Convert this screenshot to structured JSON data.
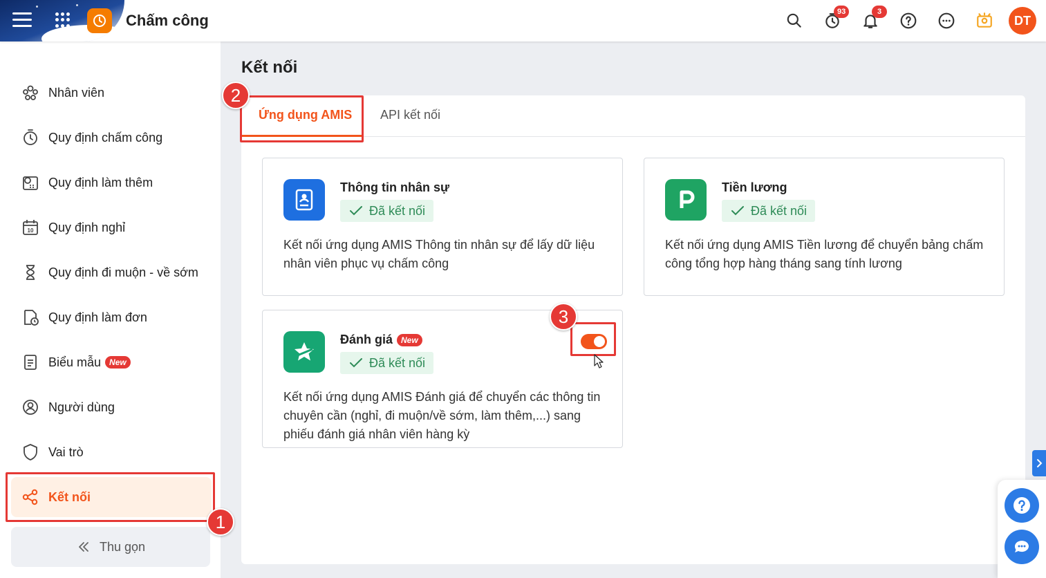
{
  "app": {
    "title": "Chấm công"
  },
  "header": {
    "timer_badge": "93",
    "notification_badge": "3",
    "avatar_initials": "DT",
    "icons": [
      "search-icon",
      "timer-icon",
      "bell-icon",
      "help-icon",
      "more-icon",
      "idea-icon"
    ]
  },
  "sidebar": {
    "items": [
      {
        "label": "Nhân viên",
        "icon": "employees-icon"
      },
      {
        "label": "Quy định chấm công",
        "icon": "stopwatch-icon"
      },
      {
        "label": "Quy định làm thêm",
        "icon": "overtime-icon"
      },
      {
        "label": "Quy định nghỉ",
        "icon": "calendar-icon"
      },
      {
        "label": "Quy định đi muộn - về sớm",
        "icon": "hourglass-icon"
      },
      {
        "label": "Quy định làm đơn",
        "icon": "document-clock-icon"
      },
      {
        "label": "Biểu mẫu",
        "icon": "form-icon",
        "badge": "New"
      },
      {
        "label": "Người dùng",
        "icon": "user-icon"
      },
      {
        "label": "Vai trò",
        "icon": "shield-icon"
      },
      {
        "label": "Kết nối",
        "icon": "share-icon",
        "active": true
      }
    ],
    "collapse_label": "Thu gọn"
  },
  "main": {
    "page_title": "Kết nối",
    "tabs": [
      {
        "label": "Ứng dụng AMIS",
        "active": true
      },
      {
        "label": "API kết nối",
        "active": false
      }
    ],
    "cards": [
      {
        "title": "Thông tin nhân sự",
        "status": "Đã kết nối",
        "description": "Kết nối ứng dụng AMIS Thông tin nhân sự để lấy dữ liệu nhân viên phục vụ chấm công",
        "icon_color": "#1e6fe0"
      },
      {
        "title": "Tiền lương",
        "status": "Đã kết nối",
        "description": "Kết nối ứng dụng AMIS Tiền lương để chuyển bảng chấm công tổng hợp hàng tháng sang tính lương",
        "icon_color": "#1fa463"
      },
      {
        "title": "Đánh giá",
        "badge": "New",
        "status": "Đã kết nối",
        "description": "Kết nối ứng dụng AMIS Đánh giá để chuyển các thông tin chuyên cần (nghỉ, đi muộn/về sớm, làm thêm,...) sang phiếu đánh giá nhân viên hàng kỳ",
        "icon_color": "#17a673",
        "toggle_on": true
      }
    ]
  },
  "annotations": {
    "step1": "1",
    "step2": "2",
    "step3": "3"
  },
  "colors": {
    "accent": "#f2541b",
    "highlight": "#e53935",
    "success": "#2e8b57",
    "primary_blue": "#2c7be5"
  }
}
